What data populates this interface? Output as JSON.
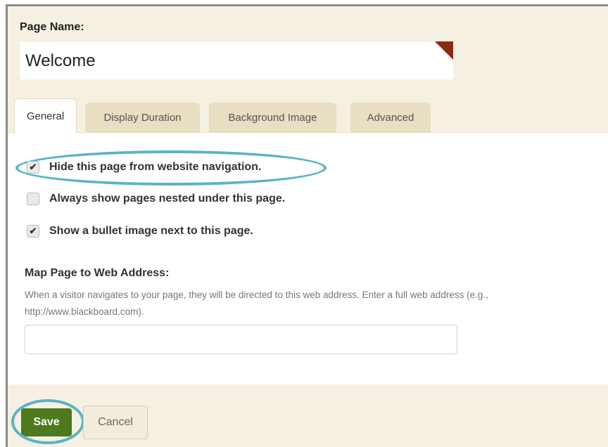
{
  "page_name": {
    "label": "Page Name:",
    "value": "Welcome"
  },
  "tabs": [
    {
      "label": "General",
      "active": true
    },
    {
      "label": "Display Duration",
      "active": false
    },
    {
      "label": "Background Image",
      "active": false
    },
    {
      "label": "Advanced",
      "active": false
    }
  ],
  "options": [
    {
      "label": "Hide this page from website navigation.",
      "checked": true
    },
    {
      "label": "Always show pages nested under this page.",
      "checked": false
    },
    {
      "label": "Show a bullet image next to this page.",
      "checked": true
    }
  ],
  "map_page": {
    "label": "Map Page to Web Address:",
    "description": "When a visitor navigates to your page, they will be directed to this web address. Enter a full web address (e.g., http://www.blackboard.com).",
    "value": ""
  },
  "footer": {
    "save_label": "Save",
    "cancel_label": "Cancel"
  },
  "colors": {
    "panel_bg": "#f5f0e1",
    "save_green": "#4e7a1e",
    "highlight": "#5bb3c6",
    "corner_accent": "#8b2a12"
  }
}
